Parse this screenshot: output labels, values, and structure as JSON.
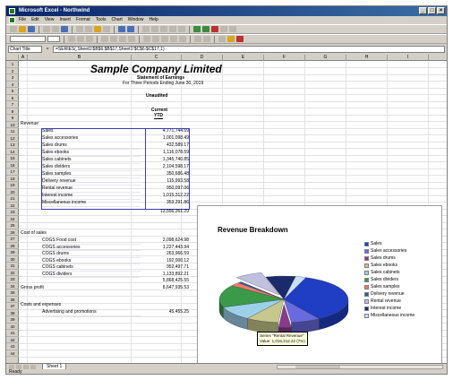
{
  "window": {
    "title": "Microsoft Excel - Northwind"
  },
  "menu": [
    "File",
    "Edit",
    "View",
    "Insert",
    "Format",
    "Tools",
    "Chart",
    "Window",
    "Help"
  ],
  "formula_bar": {
    "name_box": "Chart Title",
    "formula": "=SERIES(,Sheet1!$B$6:$B$17,Sheet1!$C$6:$C$17,1)"
  },
  "columns": [
    "A",
    "B",
    "C",
    "D",
    "E",
    "F",
    "G",
    "H",
    "I",
    "J",
    "K"
  ],
  "row_numbers": [
    "1",
    "2",
    "3",
    "4",
    "5",
    "6",
    "7",
    "8",
    "9",
    "10",
    "11",
    "12",
    "13",
    "14",
    "15",
    "16",
    "17",
    "18",
    "19",
    "20",
    "21",
    "22",
    "23",
    "24",
    "25",
    "26",
    "27",
    "28",
    "29",
    "30",
    "31",
    "32",
    "33",
    "34",
    "35",
    "36",
    "37",
    "38",
    "39",
    "40",
    "41",
    "42",
    "43",
    "44"
  ],
  "statement": {
    "company": "Sample Company Limited",
    "title": "Statement of Earnings",
    "subtitle": "For Three Periods Ending June 30, 2019",
    "audited": "Unaudited",
    "current": "Current",
    "ytd": "YTD"
  },
  "revenue_label": "Revenue",
  "revenue_items": [
    {
      "label": "Sales",
      "value": "4,771,744.69"
    },
    {
      "label": "Sales accessories",
      "value": "1,001,098.49"
    },
    {
      "label": "Sales drums",
      "value": "432,589.17"
    },
    {
      "label": "Sales ebooks",
      "value": "1,116,078.59"
    },
    {
      "label": "Sales cabinets",
      "value": "1,345,740.85"
    },
    {
      "label": "Sales dividers",
      "value": "2,104,598.17"
    },
    {
      "label": "Sales samples",
      "value": "350,686.48"
    },
    {
      "label": "Delivery revenue",
      "value": "115,993.58"
    },
    {
      "label": "Rental revenue",
      "value": "950,097.06"
    },
    {
      "label": "Interest income",
      "value": "1,015,312.22"
    },
    {
      "label": "Miscellaneous income",
      "value": "353,291.86"
    }
  ],
  "revenue_total": "13,556,261.29",
  "cost_label": "Cost of sales",
  "cost_items": [
    {
      "label": "COGS Food cost",
      "value": "2,098,624.98"
    },
    {
      "label": "COGS accessories",
      "value": "1,227,443.94"
    },
    {
      "label": "COGS drums",
      "value": "263,966.59"
    },
    {
      "label": "COGS ebooks",
      "value": "192,000.12"
    },
    {
      "label": "COGS cabinets",
      "value": "952,497.71"
    },
    {
      "label": "COGS dividers",
      "value": "1,133,892.21"
    }
  ],
  "cost_total": "5,868,425.55",
  "gross_label": "Gross profit",
  "gross_value": "8,647,935.53",
  "ops_label": "Costs and expenses",
  "ops_item": {
    "label": "Advertising and promotions",
    "value": "45,455.25"
  },
  "chart": {
    "title": "Revenue Breakdown",
    "tooltip_line1": "Series \"Rental Revenue\"",
    "tooltip_line2": "Value: 1,015,312.22 (7%)"
  },
  "chart_data": {
    "type": "pie",
    "title": "Revenue Breakdown",
    "categories": [
      "Sales",
      "Sales accessories",
      "Sales drums",
      "Sales ebooks",
      "Sales cabinets",
      "Sales dividers",
      "Sales samples",
      "Delivery revenue",
      "Rental revenue",
      "Interest income",
      "Miscellaneous income"
    ],
    "values": [
      4771744.69,
      1001098.49,
      432589.17,
      1116078.59,
      1345740.85,
      2104598.17,
      350686.48,
      115993.58,
      950097.06,
      1015312.22,
      353291.86
    ],
    "colors": [
      "#1f3ec4",
      "#6a6adf",
      "#8a3a8a",
      "#c8c88c",
      "#9bd0e8",
      "#3a9a4a",
      "#e87c6c",
      "#2c5aa0",
      "#c0c0e0",
      "#1a2a6c",
      "#c8e0f8"
    ],
    "exploded": [
      "Rental revenue",
      "Sales drums"
    ],
    "legend_position": "right"
  },
  "sheet_tab": "Sheet 1",
  "status": "Ready"
}
